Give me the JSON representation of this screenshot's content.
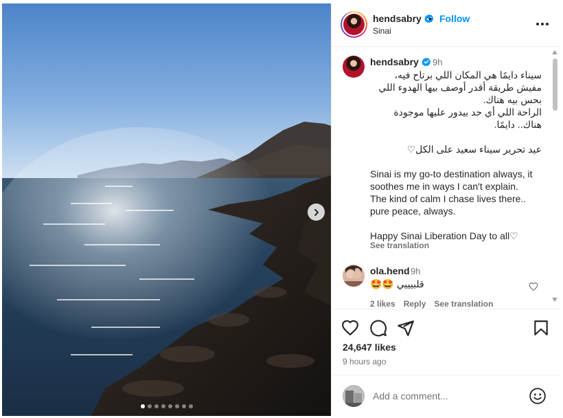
{
  "post": {
    "username": "hendsabry",
    "follow_label": "Follow",
    "separator": "•",
    "location": "Sinai",
    "carousel": {
      "total_slides": 8,
      "active_index": 0
    }
  },
  "caption": {
    "username": "hendsabry",
    "time": "9h",
    "lines_ar": [
      "سيناء دايمًا هي المكان اللي برتاح فيه،",
      "مفيش طريقة أقدر أوصف بيها الهدوء اللي",
      "بحس بيه هناك.",
      "الراحة اللي أي حد بيدور عليها موجودة",
      "هناك.. دايمًا."
    ],
    "line_ar_holiday": "عيد تحرير سيناء سعيد على الكل♡",
    "lines_en": [
      "Sinai is my go-to destination always, it",
      "soothes me in ways I can't explain.",
      "The kind of calm I chase lives there..",
      "pure peace, always."
    ],
    "line_en_holiday": "Happy Sinai Liberation Day to all♡",
    "see_translation": "See translation"
  },
  "comment": {
    "username": "ola.hend",
    "time": "9h",
    "text": "🤩🤩 قلبيييي",
    "likes": "2 likes",
    "reply": "Reply",
    "see_translation": "See translation"
  },
  "actions": {
    "icons": [
      "heart-icon",
      "comment-icon",
      "share-icon",
      "bookmark-icon"
    ],
    "likes_count": "24,647 likes",
    "posted_ago": "9 hours ago"
  },
  "add_comment": {
    "placeholder": "Add a comment..."
  },
  "colors": {
    "accent": "#0095f6",
    "verified": "#0095f6",
    "muted": "#737373"
  }
}
